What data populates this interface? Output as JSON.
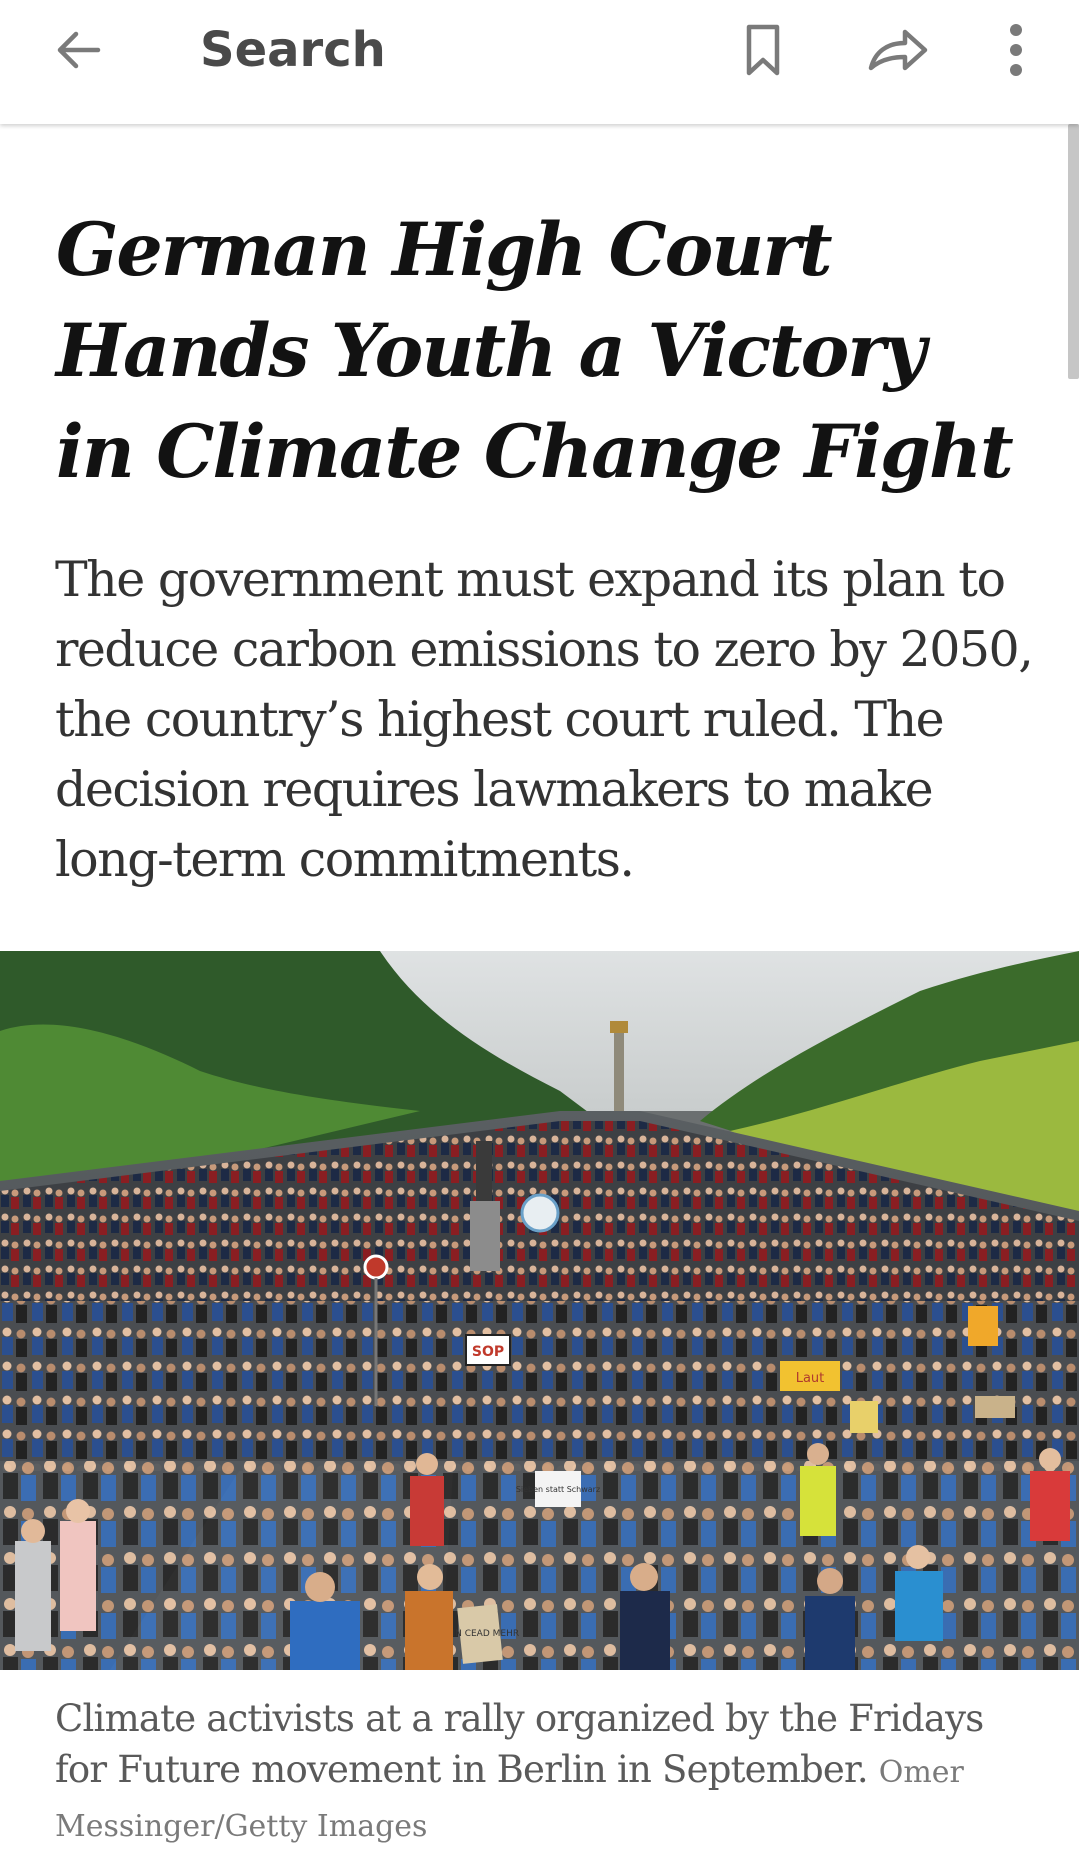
{
  "toolbar": {
    "title": "Search",
    "icons": {
      "back": "arrow-left-icon",
      "bookmark": "bookmark-icon",
      "share": "share-arrow-icon",
      "more": "more-vertical-icon"
    }
  },
  "article": {
    "headline": "German High Court Hands Youth a Victory in Climate Change Fight",
    "summary": "The government must expand its plan to reduce carbon emissions to zero by 2050, the country’s highest court ruled. The decision requires lawmakers to make long-term commitments.",
    "image": {
      "caption": "Climate activists at a rally organized by the Fridays for Future movement in Berlin in September.",
      "credit": "Omer Messinger/Getty Images",
      "signs": [
        "SOP",
        "Laut",
        "KEIN CEAD MEHR",
        "Sieben statt Schwarz"
      ]
    }
  },
  "colors": {
    "text": "#121212",
    "summary": "#333333",
    "caption": "#5a5a5a",
    "icon": "#7a7a7a"
  }
}
